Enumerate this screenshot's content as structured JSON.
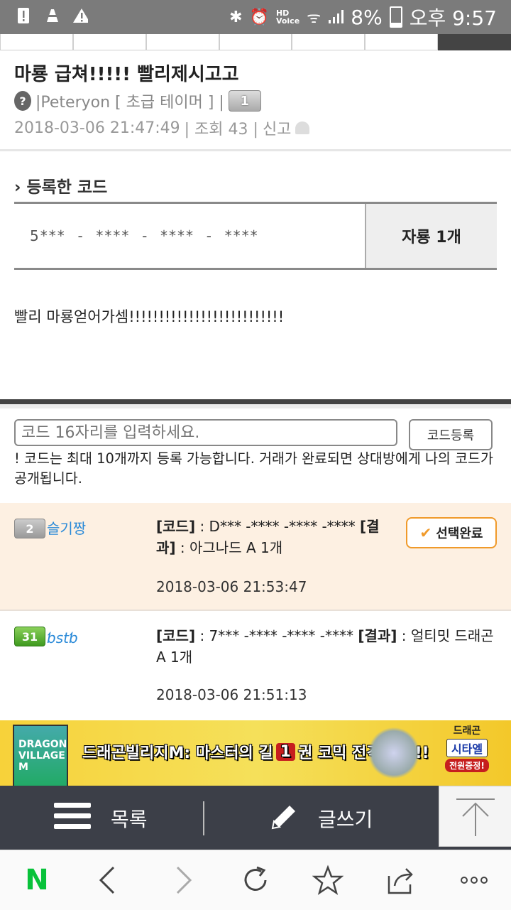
{
  "status_bar": {
    "battery": "8%",
    "time": "오후 9:57",
    "hd_label": "HD",
    "voice_label": "Voice"
  },
  "post": {
    "title": "마룡 급쳐!!!!! 빨리제시고고",
    "author": "|Peteryon [ 초급 테이머 ] |",
    "author_level": "1",
    "date": "2018-03-06 21:47:49",
    "views": "| 조회 43 |",
    "report": "신고",
    "body": "빨리 마룡얻어가셈!!!!!!!!!!!!!!!!!!!!!!!!!!"
  },
  "registered_code": {
    "heading": "› 등록한 코드",
    "mask": "5***  -  ****  -  ****  -  ****",
    "use_label": "자룡 1개"
  },
  "code_entry": {
    "placeholder": "코드 16자리를 입력하세요.",
    "register_button": "코드등록",
    "notice": "! 코드는 최대 10개까지 등록 가능합니다. 거래가 완료되면 상대방에게 나의 코드가 공개됩니다."
  },
  "comments": [
    {
      "level": "2",
      "user": "슬기짱",
      "code_label": "[코드]",
      "code": " : D*** -**** -**** -****",
      "result_label": "[결과]",
      "result": " : 아그나드 A 1개",
      "date": "2018-03-06 21:53:47",
      "select_label": "선택완료"
    },
    {
      "level": "31",
      "user": "ƅstƅ",
      "code_label": "[코드]",
      "code": " : 7*** -**** -**** -****",
      "result_label": "[결과]",
      "result": " : 얼티밋 드래곤 A 1개",
      "date": "2018-03-06 21:51:13"
    }
  ],
  "banner": {
    "book_label": "DRAGON VILLAGE M",
    "text_before": "드래곤빌리지M: 마스터의 길",
    "text_num": "1",
    "text_after": "권 코믹 전격 출시!!",
    "right_line1": "드래곤",
    "right_line2": "시타엘",
    "right_line3": "전원증정!"
  },
  "toolbar": {
    "list_label": "목록",
    "write_label": "글쓰기"
  },
  "colors": {
    "accent_orange": "#f09a2a",
    "link_blue": "#2a8ad8",
    "naver_green": "#08c23a"
  }
}
